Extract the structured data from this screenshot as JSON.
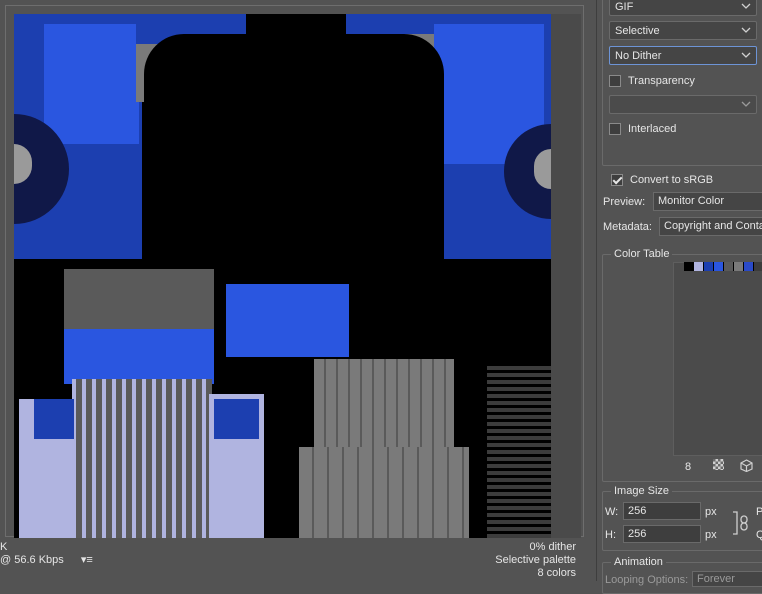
{
  "preview": {
    "status_left": [
      "K",
      "@ 56.6 Kbps"
    ],
    "status_right": [
      "0% dither",
      "Selective palette",
      "8 colors"
    ]
  },
  "settings": {
    "format": "GIF",
    "reduction": "Selective",
    "dither": "No Dither",
    "transparency_label": "Transparency",
    "transparency_checked": false,
    "matte": "",
    "interlaced_label": "Interlaced",
    "interlaced_checked": false,
    "convert_srgb_label": "Convert to sRGB",
    "convert_srgb_checked": true,
    "preview_label": "Preview:",
    "preview_value": "Monitor Color",
    "metadata_label": "Metadata:",
    "metadata_value": "Copyright and Conta"
  },
  "color_table": {
    "title": "Color Table",
    "count": "8",
    "swatches": [
      "#000000",
      "#b0b4e0",
      "#1c3fb0",
      "#2a56e0",
      "#5a5a5a",
      "#7a7a7a",
      "#2a4ac8",
      "#3c3c3c"
    ]
  },
  "image_size": {
    "title": "Image Size",
    "w_label": "W:",
    "w_value": "256",
    "h_label": "H:",
    "h_value": "256",
    "unit": "px",
    "right_w": "P",
    "right_h": "Q"
  },
  "animation": {
    "title": "Animation",
    "looping_label": "Looping Options:",
    "looping_value": "Forever"
  }
}
